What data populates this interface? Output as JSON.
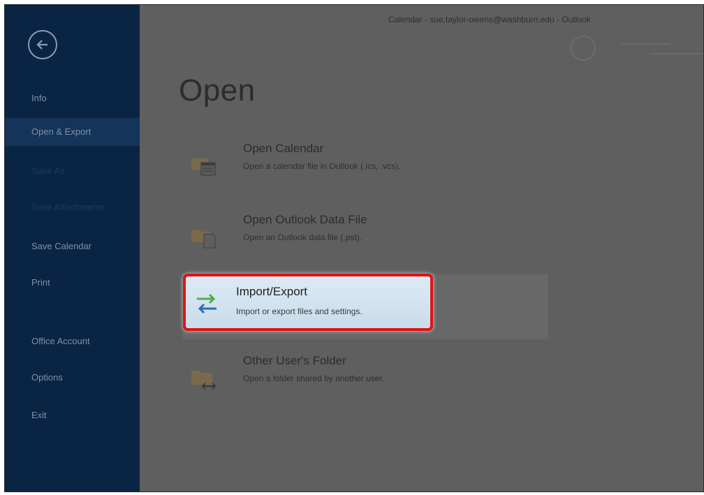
{
  "window": {
    "title": "Calendar - sue.taylor-owens@washburn.edu - Outlook"
  },
  "sidebar": {
    "items": [
      {
        "label": "Info"
      },
      {
        "label": "Open & Export",
        "selected": true
      },
      {
        "label": "Save As"
      },
      {
        "label": "Save Attachments"
      },
      {
        "label": "Save Calendar"
      },
      {
        "label": "Print"
      },
      {
        "label": "Office Account"
      },
      {
        "label": "Options"
      },
      {
        "label": "Exit"
      }
    ]
  },
  "main": {
    "title": "Open",
    "options": [
      {
        "title": "Open Calendar",
        "description": "Open a calendar file in Outlook (.ics, .vcs).",
        "icon": "calendar-folder-icon"
      },
      {
        "title": "Open Outlook Data File",
        "description": "Open an Outlook data file (.pst).",
        "icon": "data-file-folder-icon"
      },
      {
        "title": "Import/Export",
        "description": "Import or export files and settings.",
        "icon": "import-export-arrows-icon",
        "highlighted": true
      },
      {
        "title": "Other User's Folder",
        "description": "Open a folder shared by another user.",
        "icon": "shared-folder-icon"
      }
    ]
  },
  "colors": {
    "sidebar_bg": "#0a2444",
    "sidebar_selected": "#15345a",
    "content_overlay": "#5f5f5f",
    "highlight_border": "#e01414",
    "highlight_fill": "#dceaf5"
  }
}
